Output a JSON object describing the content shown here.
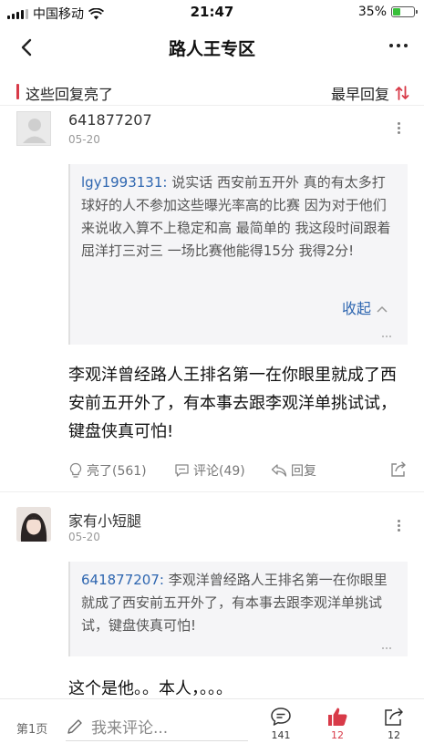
{
  "status_bar": {
    "carrier": "中国移动",
    "time": "21:47",
    "battery": "35%",
    "battery_level": 0.35,
    "battery_color": "#39c03b"
  },
  "nav": {
    "title": "路人王专区"
  },
  "section": {
    "title": "这些回复亮了",
    "sort_label": "最早回复",
    "accent": "#d83a48"
  },
  "comments": [
    {
      "username": "641877207",
      "date": "05-20",
      "quote": {
        "author": "lgy1993131:",
        "text": " 说实话 西安前五开外 真的有太多打球好的人不参加这些曝光率高的比赛 因为对于他们来说收入算不上稳定和高 最简单的 我这段时间跟着屈洋打三对三 一场比赛他能得15分 我得2分!",
        "collapse_label": "收起"
      },
      "text": "李观洋曾经路人王排名第一在你眼里就成了西安前五开外了，有本事去跟李观洋单挑试试，键盘侠真可怕!",
      "actions": {
        "likes": "亮了(561)",
        "comments": "评论(49)",
        "reply": "回复"
      }
    },
    {
      "username": "家有小短腿",
      "date": "05-20",
      "quote": {
        "author": "641877207:",
        "text": " 李观洋曾经路人王排名第一在你眼里就成了西安前五开外了，有本事去跟李观洋单挑试试，键盘侠真可怕!"
      },
      "text": "这个是他。。本人，。。。"
    }
  ],
  "bottom_bar": {
    "page": "第1页",
    "input_placeholder": "我来评论...",
    "comment_count": "141",
    "like_count": "12",
    "share_count": "12"
  },
  "colors": {
    "link": "#2e66b0",
    "accent": "#d83a48"
  }
}
